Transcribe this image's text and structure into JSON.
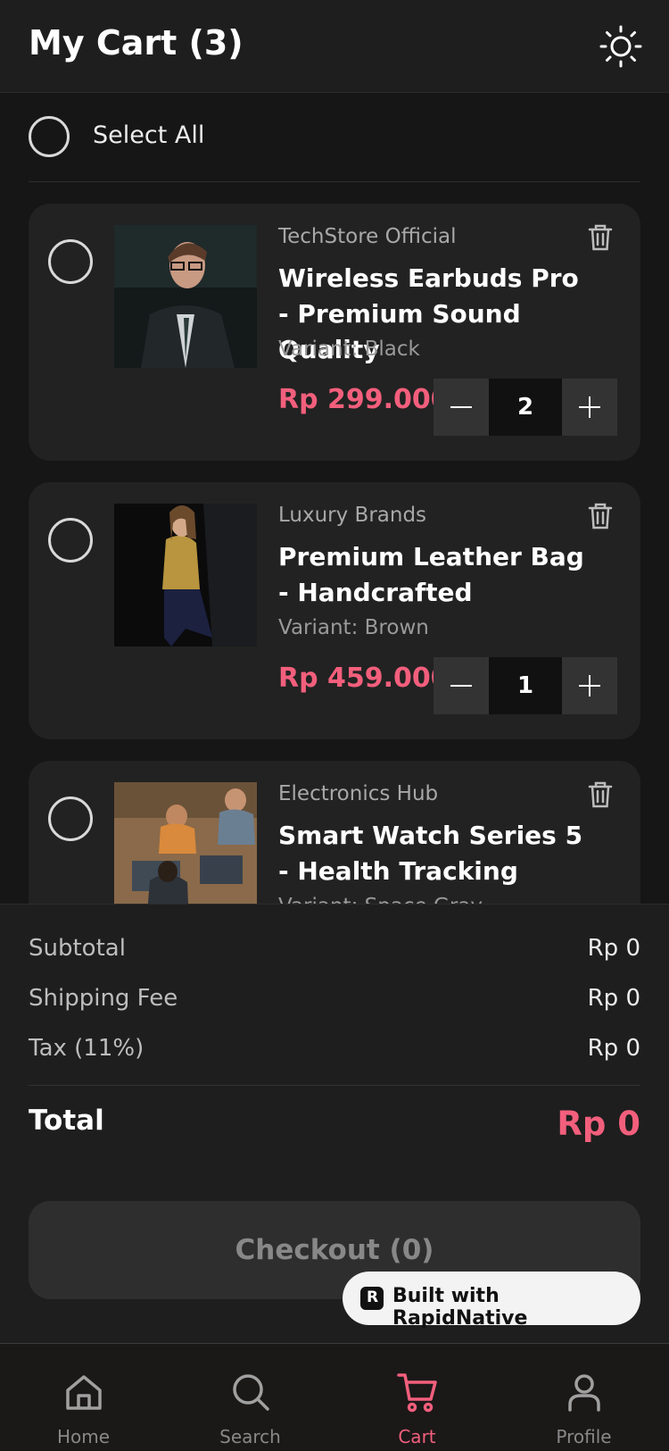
{
  "header": {
    "title": "My Cart (3)",
    "theme_icon": "sun-icon"
  },
  "select_all": {
    "label": "Select All"
  },
  "items": [
    {
      "store": "TechStore Official",
      "name": "Wireless Earbuds Pro - Premium Sound Quality",
      "variant": "Variant: Black",
      "price": "Rp 299.000",
      "qty": "2"
    },
    {
      "store": "Luxury Brands",
      "name": "Premium Leather Bag - Handcrafted",
      "variant": "Variant: Brown",
      "price": "Rp 459.000",
      "qty": "1"
    },
    {
      "store": "Electronics Hub",
      "name": "Smart Watch Series 5 - Health Tracking",
      "variant": "Variant: Space Gray",
      "price": "",
      "qty": ""
    }
  ],
  "summary": {
    "subtotal_label": "Subtotal",
    "subtotal": "Rp 0",
    "shipping_label": "Shipping Fee",
    "shipping": "Rp 0",
    "tax_label": "Tax (11%)",
    "tax": "Rp 0",
    "total_label": "Total",
    "total": "Rp 0"
  },
  "checkout_label": "Checkout (0)",
  "badge": "Built with RapidNative",
  "tabs": [
    {
      "label": "Home",
      "icon": "home-icon"
    },
    {
      "label": "Search",
      "icon": "search-icon"
    },
    {
      "label": "Cart",
      "icon": "cart-icon",
      "active": true
    },
    {
      "label": "Profile",
      "icon": "user-icon"
    }
  ],
  "colors": {
    "accent": "#f25f7c",
    "background": "#161616",
    "card": "#222222"
  }
}
